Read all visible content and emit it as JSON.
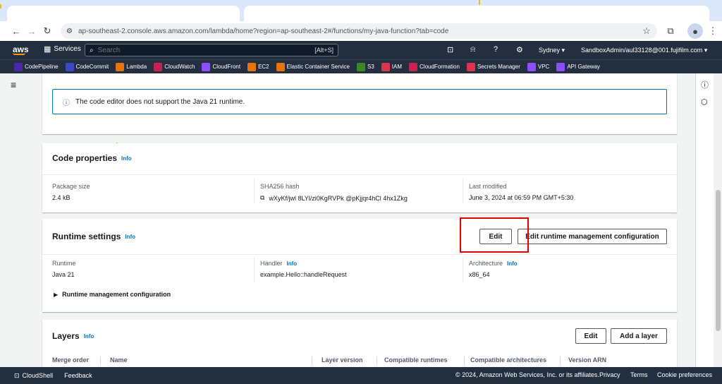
{
  "browser": {
    "url": "ap-southeast-2.console.aws.amazon.com/lambda/home?region=ap-southeast-2#/functions/my-java-function?tab=code"
  },
  "aws_nav": {
    "logo": "aws",
    "services_label": "Services",
    "search_placeholder": "Search",
    "search_shortcut": "[Alt+S]",
    "region": "Sydney ▾",
    "account": "SandboxAdmin/aul33128@001.fujifilm.com ▾"
  },
  "favorites": [
    {
      "label": "CodePipeline",
      "color": "#4d27aa"
    },
    {
      "label": "CodeCommit",
      "color": "#3b48cc"
    },
    {
      "label": "Lambda",
      "color": "#e7730b"
    },
    {
      "label": "CloudWatch",
      "color": "#c7224e"
    },
    {
      "label": "CloudFront",
      "color": "#8c4fff"
    },
    {
      "label": "EC2",
      "color": "#e7730b"
    },
    {
      "label": "Elastic Container Service",
      "color": "#e7730b"
    },
    {
      "label": "S3",
      "color": "#3f8624"
    },
    {
      "label": "IAM",
      "color": "#dd344c"
    },
    {
      "label": "CloudFormation",
      "color": "#c7224e"
    },
    {
      "label": "Secrets Manager",
      "color": "#dd344c"
    },
    {
      "label": "VPC",
      "color": "#8c4fff"
    },
    {
      "label": "API Gateway",
      "color": "#8c4fff"
    }
  ],
  "alert": {
    "text": "The code editor does not support the Java 21 runtime."
  },
  "code_properties": {
    "title": "Code properties",
    "info": "Info",
    "package_size_label": "Package size",
    "package_size_value": "2.4 kB",
    "sha_label": "SHA256 hash",
    "sha_value": "wXyKf/jwl 8LYl/zi0KgRVPk @pKjjqr4hCl 4hx1Zkg",
    "modified_label": "Last modified",
    "modified_value": "June 3, 2024 at 06:59 PM GMT+5:30"
  },
  "runtime_settings": {
    "title": "Runtime settings",
    "info": "Info",
    "edit_label": "Edit",
    "edit_runtime_mgmt_label": "Edit runtime management configuration",
    "runtime_label": "Runtime",
    "runtime_value": "Java 21",
    "handler_label": "Handler",
    "handler_info": "Info",
    "handler_value": "example.Hello::handleRequest",
    "arch_label": "Architecture",
    "arch_info": "Info",
    "arch_value": "x86_64",
    "expand_label": "Runtime management configuration"
  },
  "layers": {
    "title": "Layers",
    "info": "Info",
    "edit_label": "Edit",
    "add_label": "Add a layer",
    "columns": [
      "Merge order",
      "Name",
      "Layer version",
      "Compatible runtimes",
      "Compatible architectures",
      "Version ARN"
    ]
  },
  "footer": {
    "cloudshell": "CloudShell",
    "feedback": "Feedback",
    "copyright": "© 2024, Amazon Web Services, Inc. or its affiliates.",
    "privacy": "Privacy",
    "terms": "Terms",
    "cookies": "Cookie preferences"
  },
  "colors": {
    "highlight": "#e00000",
    "aws_orange": "#ff9900",
    "link_blue": "#0073bb"
  }
}
